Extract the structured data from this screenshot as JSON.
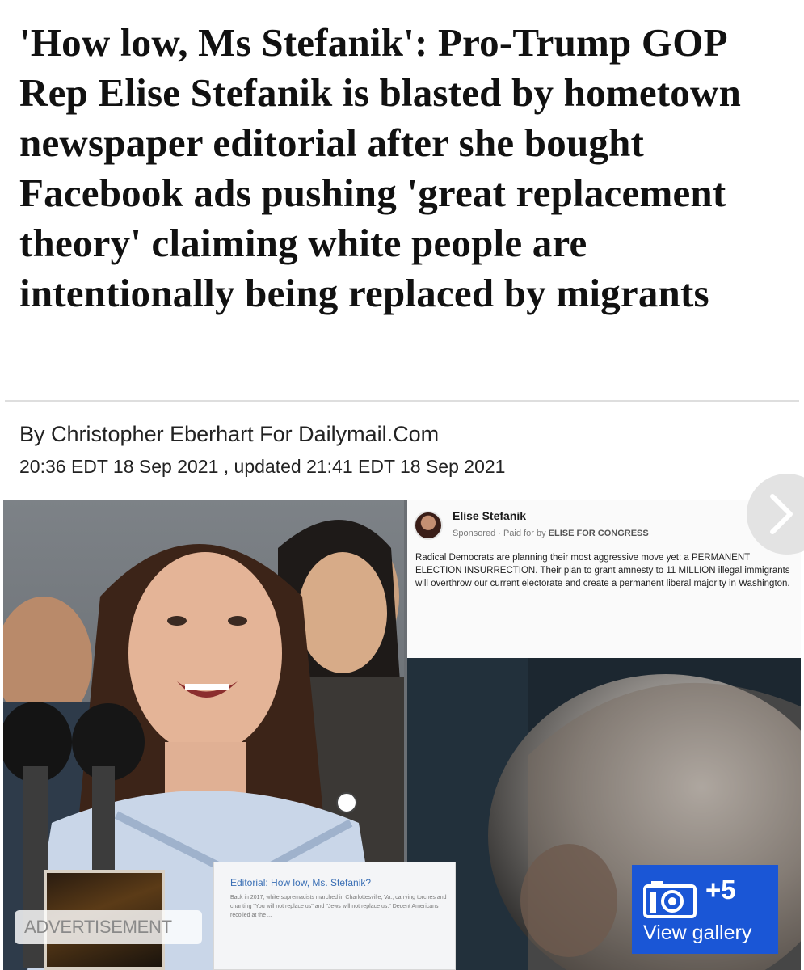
{
  "article": {
    "headline": "'How low, Ms Stefanik': Pro-Trump GOP Rep Elise Stefanik is blasted by hometown newspaper editorial after she bought Facebook ads pushing 'great replacement theory' claiming white people are intentionally being replaced by migrants",
    "byline": "By Christopher Eberhart For Dailymail.Com",
    "dates": "20:36 EDT 18 Sep 2021 , updated 21:41 EDT 18 Sep 2021"
  },
  "image": {
    "ad": {
      "name": "Elise Stefanik",
      "sponsored": "Sponsored · Paid for by",
      "sponsor": "ELISE FOR CONGRESS",
      "body": "Radical Democrats are planning their most aggressive move yet: a PERMANENT ELECTION INSURRECTION. Their plan to grant amnesty to 11 MILLION illegal immigrants will overthrow our current electorate and create a permanent liberal majority in Washington."
    },
    "editorial": {
      "title": "Editorial: How low, Ms. Stefanik?",
      "text": "Back in 2017, white supremacists marched in Charlottesville, Va., carrying torches and chanting \"You will not replace us\" and \"Jews will not replace us.\" Decent Americans recoiled at the ..."
    }
  },
  "advertisement_label": "ADVERTISEMENT",
  "gallery": {
    "count": "+5",
    "label": "View gallery",
    "icon": "camera-icon"
  },
  "colors": {
    "gallery_blue": "#1a56d6",
    "editorial_link": "#3a6fb5"
  }
}
